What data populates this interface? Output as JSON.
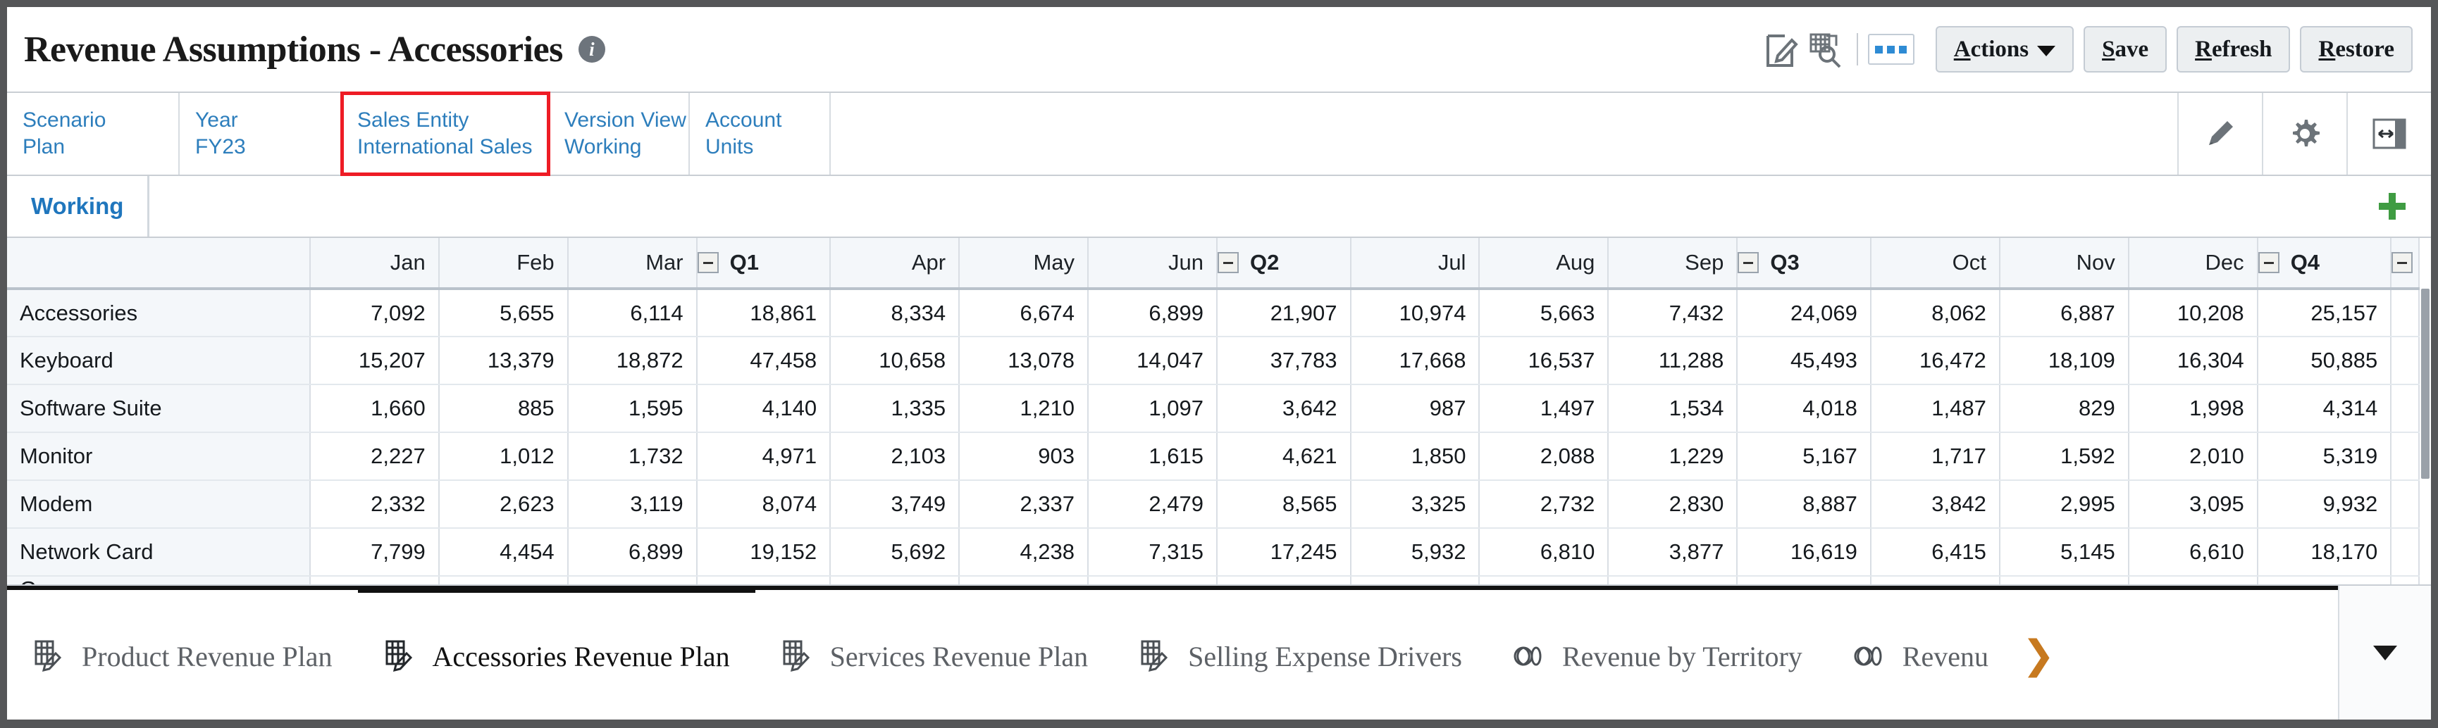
{
  "header": {
    "title": "Revenue Assumptions - Accessories",
    "info_icon": "info-icon",
    "toolbar": {
      "edit_icon": "edit-form-icon",
      "inspect_icon": "grid-search-icon",
      "more_icon": "more-options-icon",
      "actions_label": "Actions",
      "actions_accesskey": "A",
      "save_label": "Save",
      "save_accesskey": "S",
      "refresh_label": "Refresh",
      "refresh_accesskey": "R",
      "restore_label": "Restore",
      "restore_accesskey": "R"
    }
  },
  "pov": {
    "cells": [
      {
        "dimension": "Scenario",
        "member": "Plan",
        "highlighted": false
      },
      {
        "dimension": "Year",
        "member": "FY23",
        "highlighted": false
      },
      {
        "dimension": "Sales Entity",
        "member": "International Sales",
        "highlighted": true
      },
      {
        "dimension": "Version View",
        "member": "Working",
        "highlighted": false
      },
      {
        "dimension": "Account",
        "member": "Units",
        "highlighted": false
      }
    ],
    "highlight_color": "#ee1c25",
    "link_color": "#2d7ebc",
    "icons": [
      "pencil-icon",
      "gear-icon",
      "panel-resize-icon"
    ]
  },
  "working_tabs": {
    "tabs": [
      "Working"
    ],
    "add_icon": "add-plus-icon",
    "add_color": "#3f9c42"
  },
  "grid": {
    "row_header_label": "",
    "columns": [
      {
        "label": "Jan",
        "type": "month"
      },
      {
        "label": "Feb",
        "type": "month"
      },
      {
        "label": "Mar",
        "type": "month"
      },
      {
        "label": "Q1",
        "type": "quarter"
      },
      {
        "label": "Apr",
        "type": "month"
      },
      {
        "label": "May",
        "type": "month"
      },
      {
        "label": "Jun",
        "type": "month"
      },
      {
        "label": "Q2",
        "type": "quarter"
      },
      {
        "label": "Jul",
        "type": "month"
      },
      {
        "label": "Aug",
        "type": "month"
      },
      {
        "label": "Sep",
        "type": "month"
      },
      {
        "label": "Q3",
        "type": "quarter"
      },
      {
        "label": "Oct",
        "type": "month"
      },
      {
        "label": "Nov",
        "type": "month"
      },
      {
        "label": "Dec",
        "type": "month"
      },
      {
        "label": "Q4",
        "type": "quarter"
      }
    ],
    "rows": [
      {
        "label": "Accessories",
        "values": [
          "7,092",
          "5,655",
          "6,114",
          "18,861",
          "8,334",
          "6,674",
          "6,899",
          "21,907",
          "10,974",
          "5,663",
          "7,432",
          "24,069",
          "8,062",
          "6,887",
          "10,208",
          "25,157"
        ]
      },
      {
        "label": "Keyboard",
        "values": [
          "15,207",
          "13,379",
          "18,872",
          "47,458",
          "10,658",
          "13,078",
          "14,047",
          "37,783",
          "17,668",
          "16,537",
          "11,288",
          "45,493",
          "16,472",
          "18,109",
          "16,304",
          "50,885"
        ]
      },
      {
        "label": "Software Suite",
        "values": [
          "1,660",
          "885",
          "1,595",
          "4,140",
          "1,335",
          "1,210",
          "1,097",
          "3,642",
          "987",
          "1,497",
          "1,534",
          "4,018",
          "1,487",
          "829",
          "1,998",
          "4,314"
        ]
      },
      {
        "label": "Monitor",
        "values": [
          "2,227",
          "1,012",
          "1,732",
          "4,971",
          "2,103",
          "903",
          "1,615",
          "4,621",
          "1,850",
          "2,088",
          "1,229",
          "5,167",
          "1,717",
          "1,592",
          "2,010",
          "5,319"
        ]
      },
      {
        "label": "Modem",
        "values": [
          "2,332",
          "2,623",
          "3,119",
          "8,074",
          "3,749",
          "2,337",
          "2,479",
          "8,565",
          "3,325",
          "2,732",
          "2,830",
          "8,887",
          "3,842",
          "2,995",
          "3,095",
          "9,932"
        ]
      },
      {
        "label": "Network Card",
        "values": [
          "7,799",
          "4,454",
          "6,899",
          "19,152",
          "5,692",
          "4,238",
          "7,315",
          "17,245",
          "5,932",
          "6,810",
          "3,877",
          "16,619",
          "6,415",
          "5,145",
          "6,610",
          "18,170"
        ]
      }
    ],
    "partial_row_label": "Game",
    "collapse_icon": "collapse-minus-icon"
  },
  "bottom_tabs": {
    "tabs": [
      {
        "label": "Product Revenue Plan",
        "icon": "form-grid-icon",
        "active": false
      },
      {
        "label": "Accessories Revenue Plan",
        "icon": "form-grid-icon",
        "active": true
      },
      {
        "label": "Services Revenue Plan",
        "icon": "form-grid-icon",
        "active": false
      },
      {
        "label": "Selling Expense Drivers",
        "icon": "form-grid-icon",
        "active": false
      },
      {
        "label": "Revenue by Territory",
        "icon": "dashboard-icon",
        "active": false
      },
      {
        "label": "Revenu",
        "icon": "dashboard-icon",
        "active": false
      }
    ],
    "next_icon": "chevron-right-icon",
    "dropdown_icon": "chevron-down-icon"
  }
}
